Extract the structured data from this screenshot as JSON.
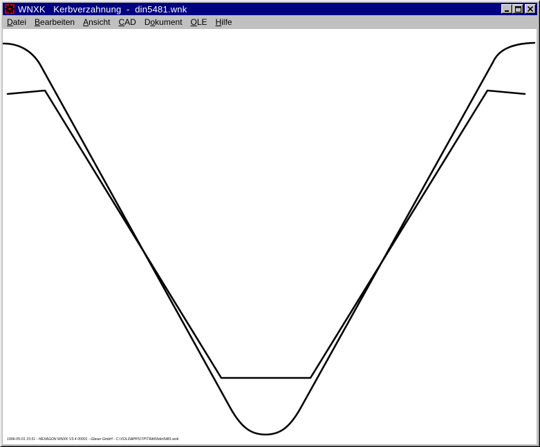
{
  "window": {
    "title": "WNXK   Kerbverzahnung  -  din5481.wnk",
    "icon": "gear-app-icon",
    "controls": [
      "minimize-icon",
      "maximize-icon",
      "close-icon"
    ]
  },
  "menu": {
    "items": [
      {
        "accel": "D",
        "rest": "atei"
      },
      {
        "accel": "B",
        "rest": "earbeiten"
      },
      {
        "accel": "A",
        "rest": "nsicht"
      },
      {
        "accel": "C",
        "rest": "AD"
      },
      {
        "pre": "D",
        "accel": "o",
        "rest": "kument"
      },
      {
        "accel": "O",
        "rest": "LE"
      },
      {
        "accel": "H",
        "rest": "ilfe"
      }
    ]
  },
  "drawing": {
    "description_line": "1996-05-01 15:51 - HEXAGON WNXK V3.4 00001 - Glaser GmbH - C:\\VOL3\\APPS\\TP\\TRAIN\\din5481.wnk",
    "stroke_color": "#000000"
  },
  "colors": {
    "titlebar": "#000080",
    "face": "#c0c0c0",
    "canvas": "#ffffff"
  }
}
